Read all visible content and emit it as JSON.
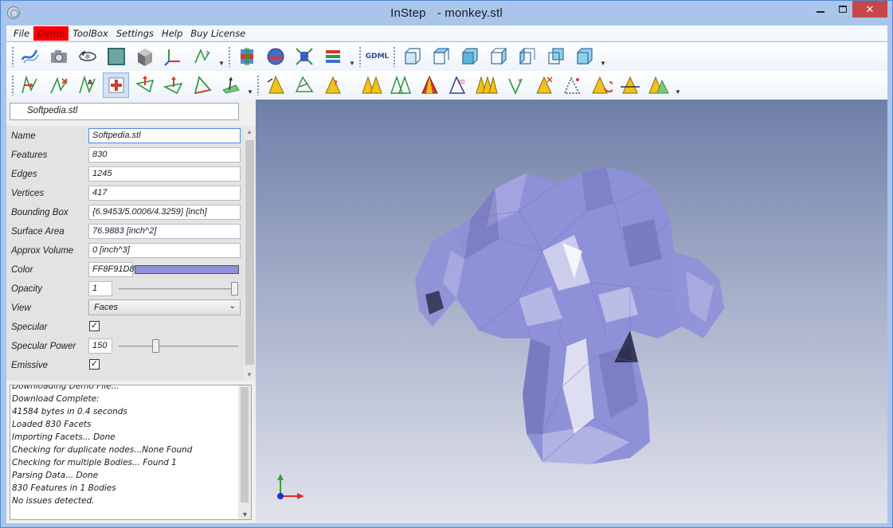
{
  "window": {
    "app_name": "InStep",
    "file_name": "- monkey.stl"
  },
  "menu": [
    "File",
    "Demo",
    "ToolBox",
    "Settings",
    "Help",
    "Buy License"
  ],
  "toolbar": {
    "gdml_label": "GDML"
  },
  "file_tree": {
    "selected": "Softpedia.stl"
  },
  "properties": {
    "name_label": "Name",
    "name_value": "Softpedia.stl",
    "features_label": "Features",
    "features_value": "830",
    "edges_label": "Edges",
    "edges_value": "1245",
    "vertices_label": "Vertices",
    "vertices_value": "417",
    "bbox_label": "Bounding Box",
    "bbox_value": "{6.9453/5.0006/4.3259} [inch]",
    "area_label": "Surface Area",
    "area_value": "76.9883 [inch^2]",
    "volume_label": "Approx Volume",
    "volume_value": "0 [inch^3]",
    "color_label": "Color",
    "color_value": "FF8F91D8",
    "color_hex": "#8F91D8",
    "opacity_label": "Opacity",
    "opacity_value": "1",
    "opacity_level": 1.0,
    "view_label": "View",
    "view_value": "Faces",
    "specular_label": "Specular",
    "specular_checked": true,
    "specular_power_label": "Specular Power",
    "specular_power_value": "150",
    "specular_power_level": 0.3,
    "emissive_label": "Emissive",
    "emissive_checked": true
  },
  "log": [
    "Downloading Demo File...",
    "Download Complete:",
    "41584 bytes in 0.4 seconds",
    "Loaded 830 Facets",
    "Importing Facets... Done",
    "Checking for duplicate nodes...None Found",
    "Checking for multiple Bodies... Found 1",
    "Parsing Data... Done",
    "830 Features in 1 Bodies",
    "No issues detected."
  ],
  "viewport": {
    "model_color": "#8F91D8"
  }
}
